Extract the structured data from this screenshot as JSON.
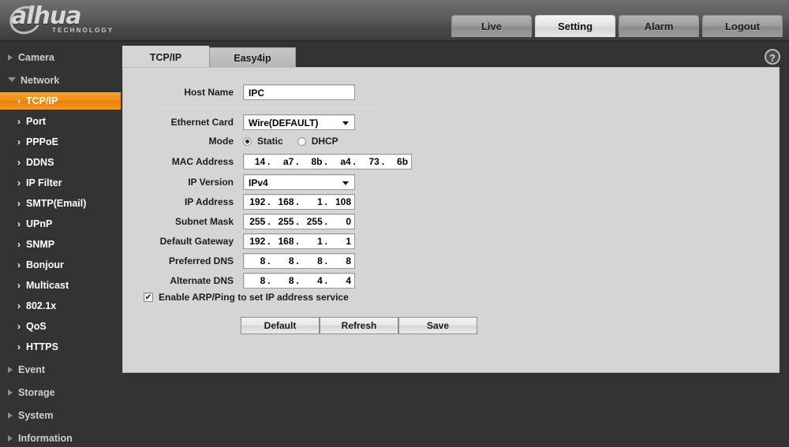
{
  "header": {
    "logo_text": "alhua",
    "logo_sub": "TECHNOLOGY",
    "nav": [
      {
        "label": "Live",
        "active": false
      },
      {
        "label": "Setting",
        "active": true
      },
      {
        "label": "Alarm",
        "active": false
      },
      {
        "label": "Logout",
        "active": false
      }
    ]
  },
  "sidebar": {
    "items": [
      {
        "label": "Camera",
        "level": "top",
        "expanded": false
      },
      {
        "label": "Network",
        "level": "top",
        "expanded": true
      },
      {
        "label": "TCP/IP",
        "level": "sub",
        "active": true
      },
      {
        "label": "Port",
        "level": "sub",
        "active": false
      },
      {
        "label": "PPPoE",
        "level": "sub",
        "active": false
      },
      {
        "label": "DDNS",
        "level": "sub",
        "active": false
      },
      {
        "label": "IP Filter",
        "level": "sub",
        "active": false
      },
      {
        "label": "SMTP(Email)",
        "level": "sub",
        "active": false
      },
      {
        "label": "UPnP",
        "level": "sub",
        "active": false
      },
      {
        "label": "SNMP",
        "level": "sub",
        "active": false
      },
      {
        "label": "Bonjour",
        "level": "sub",
        "active": false
      },
      {
        "label": "Multicast",
        "level": "sub",
        "active": false
      },
      {
        "label": "802.1x",
        "level": "sub",
        "active": false
      },
      {
        "label": "QoS",
        "level": "sub",
        "active": false
      },
      {
        "label": "HTTPS",
        "level": "sub",
        "active": false
      },
      {
        "label": "Event",
        "level": "top",
        "expanded": false
      },
      {
        "label": "Storage",
        "level": "top",
        "expanded": false
      },
      {
        "label": "System",
        "level": "top",
        "expanded": false
      },
      {
        "label": "Information",
        "level": "top",
        "expanded": false
      }
    ]
  },
  "content": {
    "tabs": [
      {
        "label": "TCP/IP",
        "active": true
      },
      {
        "label": "Easy4ip",
        "active": false
      }
    ],
    "help_icon": "?",
    "fields": {
      "host_name": {
        "label": "Host Name",
        "value": "IPC"
      },
      "ethernet_card": {
        "label": "Ethernet Card",
        "value": "Wire(DEFAULT)"
      },
      "mode": {
        "label": "Mode",
        "options": [
          {
            "label": "Static",
            "selected": true
          },
          {
            "label": "DHCP",
            "selected": false
          }
        ]
      },
      "mac_address": {
        "label": "MAC Address",
        "octets": [
          "14",
          "a7",
          "8b",
          "a4",
          "73",
          "6b"
        ]
      },
      "ip_version": {
        "label": "IP Version",
        "value": "IPv4"
      },
      "ip_address": {
        "label": "IP Address",
        "octets": [
          "192",
          "168",
          "1",
          "108"
        ]
      },
      "subnet_mask": {
        "label": "Subnet Mask",
        "octets": [
          "255",
          "255",
          "255",
          "0"
        ]
      },
      "default_gateway": {
        "label": "Default Gateway",
        "octets": [
          "192",
          "168",
          "1",
          "1"
        ]
      },
      "preferred_dns": {
        "label": "Preferred DNS",
        "octets": [
          "8",
          "8",
          "8",
          "8"
        ]
      },
      "alternate_dns": {
        "label": "Alternate DNS",
        "octets": [
          "8",
          "8",
          "4",
          "4"
        ]
      }
    },
    "arp_ping": {
      "label": "Enable ARP/Ping to set IP address service",
      "checked": true,
      "check_glyph": "✔"
    },
    "buttons": [
      {
        "label": "Default"
      },
      {
        "label": "Refresh"
      },
      {
        "label": "Save"
      }
    ]
  },
  "colors": {
    "accent": "#f08c17",
    "header_dark": "#333333",
    "panel_bg": "#d5d5d5"
  }
}
